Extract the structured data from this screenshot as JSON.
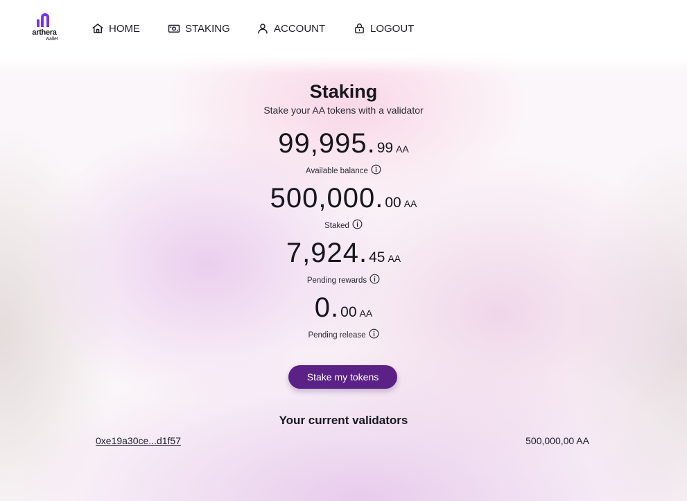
{
  "brand": {
    "logo_word": "arthera",
    "logo_sub": "wallet",
    "accent": "#5a2186",
    "logo_color": "#7b2ff7"
  },
  "nav": {
    "home": {
      "label": "HOME",
      "icon": "home-icon"
    },
    "staking": {
      "label": "STAKING",
      "icon": "cash-icon"
    },
    "account": {
      "label": "ACCOUNT",
      "icon": "user-icon"
    },
    "logout": {
      "label": "LOGOUT",
      "icon": "lock-icon"
    }
  },
  "page": {
    "title": "Staking",
    "subtitle": "Stake your AA tokens with a validator"
  },
  "stats": {
    "available": {
      "int": "99,995.",
      "dec": "99",
      "unit": "AA",
      "label": "Available balance"
    },
    "staked": {
      "int": "500,000.",
      "dec": "00",
      "unit": "AA",
      "label": "Staked"
    },
    "pending_rewards": {
      "int": "7,924.",
      "dec": "45",
      "unit": "AA",
      "label": "Pending rewards"
    },
    "pending_release": {
      "int": "0.",
      "dec": "00",
      "unit": "AA",
      "label": "Pending release"
    }
  },
  "stake_button": {
    "label": "Stake my tokens"
  },
  "validators": {
    "title": "Your current validators",
    "rows": [
      {
        "address": "0xe19a30ce...d1f57",
        "amount": "500,000,00 AA"
      }
    ]
  }
}
